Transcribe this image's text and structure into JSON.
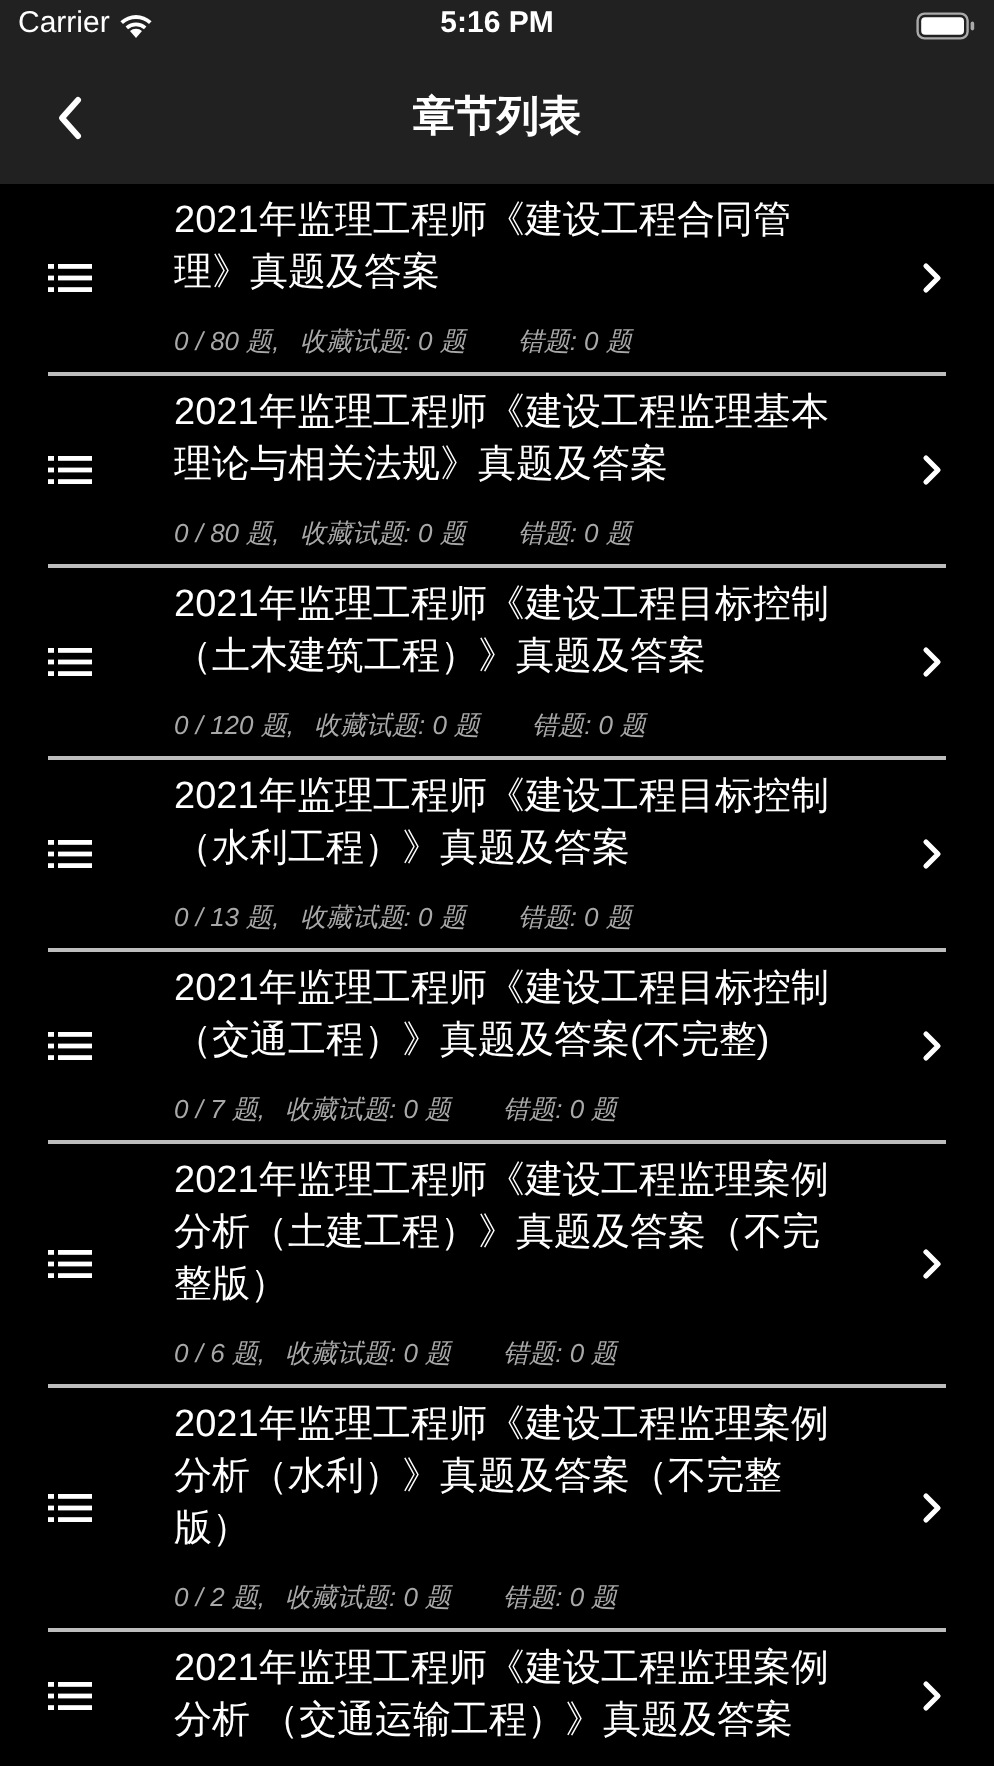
{
  "status_bar": {
    "carrier": "Carrier",
    "time": "5:16 PM"
  },
  "nav": {
    "title": "章节列表"
  },
  "chapters": [
    {
      "title": "2021年监理工程师《建设工程合同管理》真题及答案",
      "progress": "0 / 80 题,",
      "favorites": "收藏试题: 0 题",
      "wrong": "错题: 0 题"
    },
    {
      "title": "2021年监理工程师《建设工程监理基本理论与相关法规》真题及答案",
      "progress": "0 / 80 题,",
      "favorites": "收藏试题: 0 题",
      "wrong": "错题: 0 题"
    },
    {
      "title": "2021年监理工程师《建设工程目标控制（土木建筑工程）》真题及答案",
      "progress": "0 / 120 题,",
      "favorites": "收藏试题: 0 题",
      "wrong": "错题: 0 题"
    },
    {
      "title": "2021年监理工程师《建设工程目标控制（水利工程）》真题及答案",
      "progress": "0 / 13 题,",
      "favorites": "收藏试题: 0 题",
      "wrong": "错题: 0 题"
    },
    {
      "title": "2021年监理工程师《建设工程目标控制（交通工程）》真题及答案(不完整)",
      "progress": "0 / 7 题,",
      "favorites": "收藏试题: 0 题",
      "wrong": "错题: 0 题"
    },
    {
      "title": "2021年监理工程师《建设工程监理案例分析（土建工程）》真题及答案（不完整版）",
      "progress": "0 / 6 题,",
      "favorites": "收藏试题: 0 题",
      "wrong": "错题: 0 题"
    },
    {
      "title": "2021年监理工程师《建设工程监理案例分析（水利）》真题及答案（不完整版）",
      "progress": "0 / 2 题,",
      "favorites": "收藏试题: 0 题",
      "wrong": "错题: 0 题"
    },
    {
      "title": "2021年监理工程师《建设工程监理案例分析 （交通运输工程）》真题及答案"
    }
  ]
}
